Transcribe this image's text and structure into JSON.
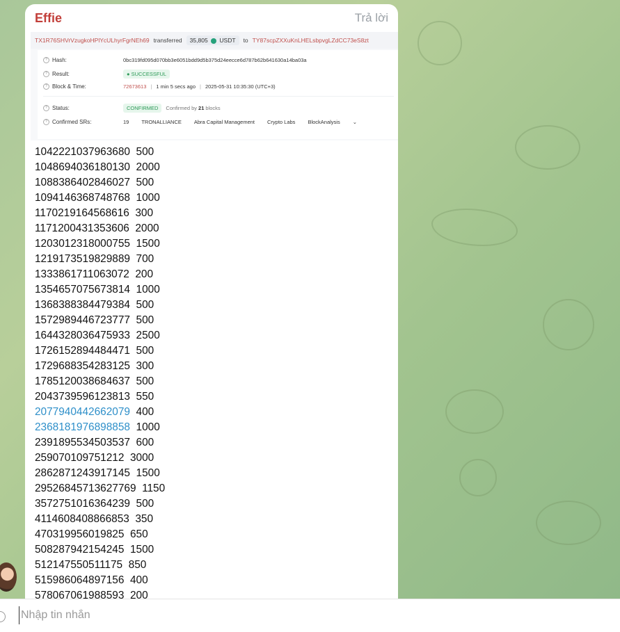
{
  "message": {
    "sender": "Effie",
    "reply_label": "Trả lời",
    "screenshot": {
      "from_address": "TX1R76SHVrVzugkoHPlYcULhyrFgrNEh69",
      "transferred_label": "transferred",
      "amount": "35,805",
      "token": "USDT",
      "to_label": "to",
      "to_address": "TY87scpZXXuKnLHELsbpvgLZdCC73eS8zt",
      "hash_label": "Hash:",
      "hash_value": "0bc319fd095d070bb3e6051bdd9d5b375d24eecce6d787b62b641630a14ba03a",
      "result_label": "Result:",
      "result_value": "SUCCESSFUL",
      "block_label": "Block & Time:",
      "block_number": "72673613",
      "block_ago": "1 min 5 secs ago",
      "block_time": "2025-05-31 10:35:30  (UTC+3)",
      "status_label": "Status:",
      "status_value": "CONFIRMED",
      "confirmed_by_prefix": "Confirmed by",
      "confirmed_by_count": "21",
      "confirmed_by_suffix": "blocks",
      "srs_label": "Confirmed SRs:",
      "srs_count": "19",
      "srs": [
        "TRONALLIANCE",
        "Abra Capital Management",
        "Crypto Labs",
        "BlockAnalysis"
      ]
    },
    "lines": [
      {
        "id": "1042221037963680",
        "amount": "500",
        "link": false
      },
      {
        "id": "1048694036180130",
        "amount": "2000",
        "link": false
      },
      {
        "id": "1088386402846027",
        "amount": "500",
        "link": false
      },
      {
        "id": "1094146368748768",
        "amount": "1000",
        "link": false
      },
      {
        "id": "1170219164568616",
        "amount": "300",
        "link": false
      },
      {
        "id": "1171200431353606",
        "amount": "2000",
        "link": false
      },
      {
        "id": "1203012318000755",
        "amount": "1500",
        "link": false
      },
      {
        "id": "1219173519829889",
        "amount": "700",
        "link": false
      },
      {
        "id": "1333861711063072",
        "amount": "200",
        "link": false
      },
      {
        "id": "1354657075673814",
        "amount": "1000",
        "link": false
      },
      {
        "id": "1368388384479384",
        "amount": "500",
        "link": false
      },
      {
        "id": "1572989446723777",
        "amount": "500",
        "link": false
      },
      {
        "id": "1644328036475933",
        "amount": "2500",
        "link": false
      },
      {
        "id": "1726152894484471",
        "amount": "500",
        "link": false
      },
      {
        "id": "1729688354283125",
        "amount": "300",
        "link": false
      },
      {
        "id": "1785120038684637",
        "amount": "500",
        "link": false
      },
      {
        "id": "2043739596123813",
        "amount": "550",
        "link": false
      },
      {
        "id": "2077940442662079",
        "amount": "400",
        "link": true
      },
      {
        "id": "2368181976898858",
        "amount": "1000",
        "link": true
      },
      {
        "id": "2391895534503537",
        "amount": "600",
        "link": false
      },
      {
        "id": "259070109751212",
        "amount": "3000",
        "link": false
      },
      {
        "id": "2862871243917145",
        "amount": "1500",
        "link": false
      },
      {
        "id": "29526845713627769",
        "amount": "1150",
        "link": false
      },
      {
        "id": "3572751016364239",
        "amount": "500",
        "link": false
      },
      {
        "id": "4114608408866853",
        "amount": "350",
        "link": false
      },
      {
        "id": "470319956019825",
        "amount": "650",
        "link": false
      },
      {
        "id": "508287942154245",
        "amount": "1500",
        "link": false
      },
      {
        "id": "512147550511175",
        "amount": "850",
        "link": false
      },
      {
        "id": "515986064897156",
        "amount": "400",
        "link": false
      },
      {
        "id": "578067061988593",
        "amount": "200",
        "link": false
      }
    ]
  },
  "composer": {
    "placeholder": "Nhập tin nhắn"
  },
  "colors": {
    "sender": "#c23f3a",
    "link": "#2e8fc9",
    "address": "#c0504d",
    "success": "#2e9a58"
  }
}
